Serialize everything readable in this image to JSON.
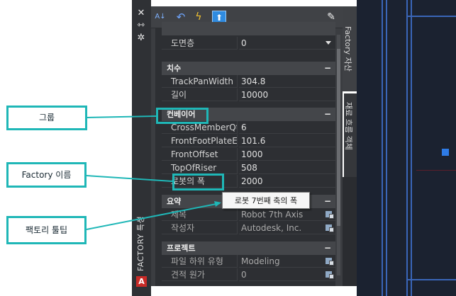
{
  "strip": {
    "label": "FACTORY 특성",
    "logo": "A"
  },
  "toolbar": {
    "sort_icon": "A↓",
    "undo_icon": "↶",
    "lightning_icon": "ϟ",
    "active_icon": "⬆",
    "edit_icon": "✎"
  },
  "sections": [
    {
      "label": "",
      "rows": [
        {
          "key": "도면층",
          "value": "0"
        }
      ]
    },
    {
      "label": "치수",
      "rows": [
        {
          "key": "TrackPanWidth",
          "value": "304.8"
        },
        {
          "key": "길이",
          "value": "10000"
        }
      ]
    },
    {
      "label": "컨베이어",
      "rows": [
        {
          "key": "CrossMemberQty",
          "value": "6"
        },
        {
          "key": "FrontFootPlateExtension",
          "value": "101.6"
        },
        {
          "key": "FrontOffset",
          "value": "1000"
        },
        {
          "key": "TopOfRiser",
          "value": "508"
        },
        {
          "key": "로봇의 폭",
          "value": "2000"
        }
      ]
    },
    {
      "label": "요약",
      "rows": [
        {
          "key": "제목",
          "value": "Robot 7th Axis"
        },
        {
          "key": "작성자",
          "value": "Autodesk, Inc."
        }
      ]
    },
    {
      "label": "프로젝트",
      "rows": [
        {
          "key": "파일 하위 유형",
          "value": "Modeling"
        },
        {
          "key": "견적 원가",
          "value": "0"
        }
      ]
    }
  ],
  "collapse_glyph": "−",
  "tabs": {
    "factory_assets": "Factory 자산",
    "material_flow": "재료 흐름 객체"
  },
  "tooltip": "로봇 7번째 축의 폭",
  "callouts": {
    "group": "그룹",
    "factory_name": "Factory 이름",
    "factory_tooltip": "팩토리 툴팁"
  },
  "colors": {
    "callout_accent": "#1fb7b7",
    "panel_bg": "#3b3d41",
    "cad_background": "#1b2230",
    "cad_lines": "#3a66b8"
  }
}
